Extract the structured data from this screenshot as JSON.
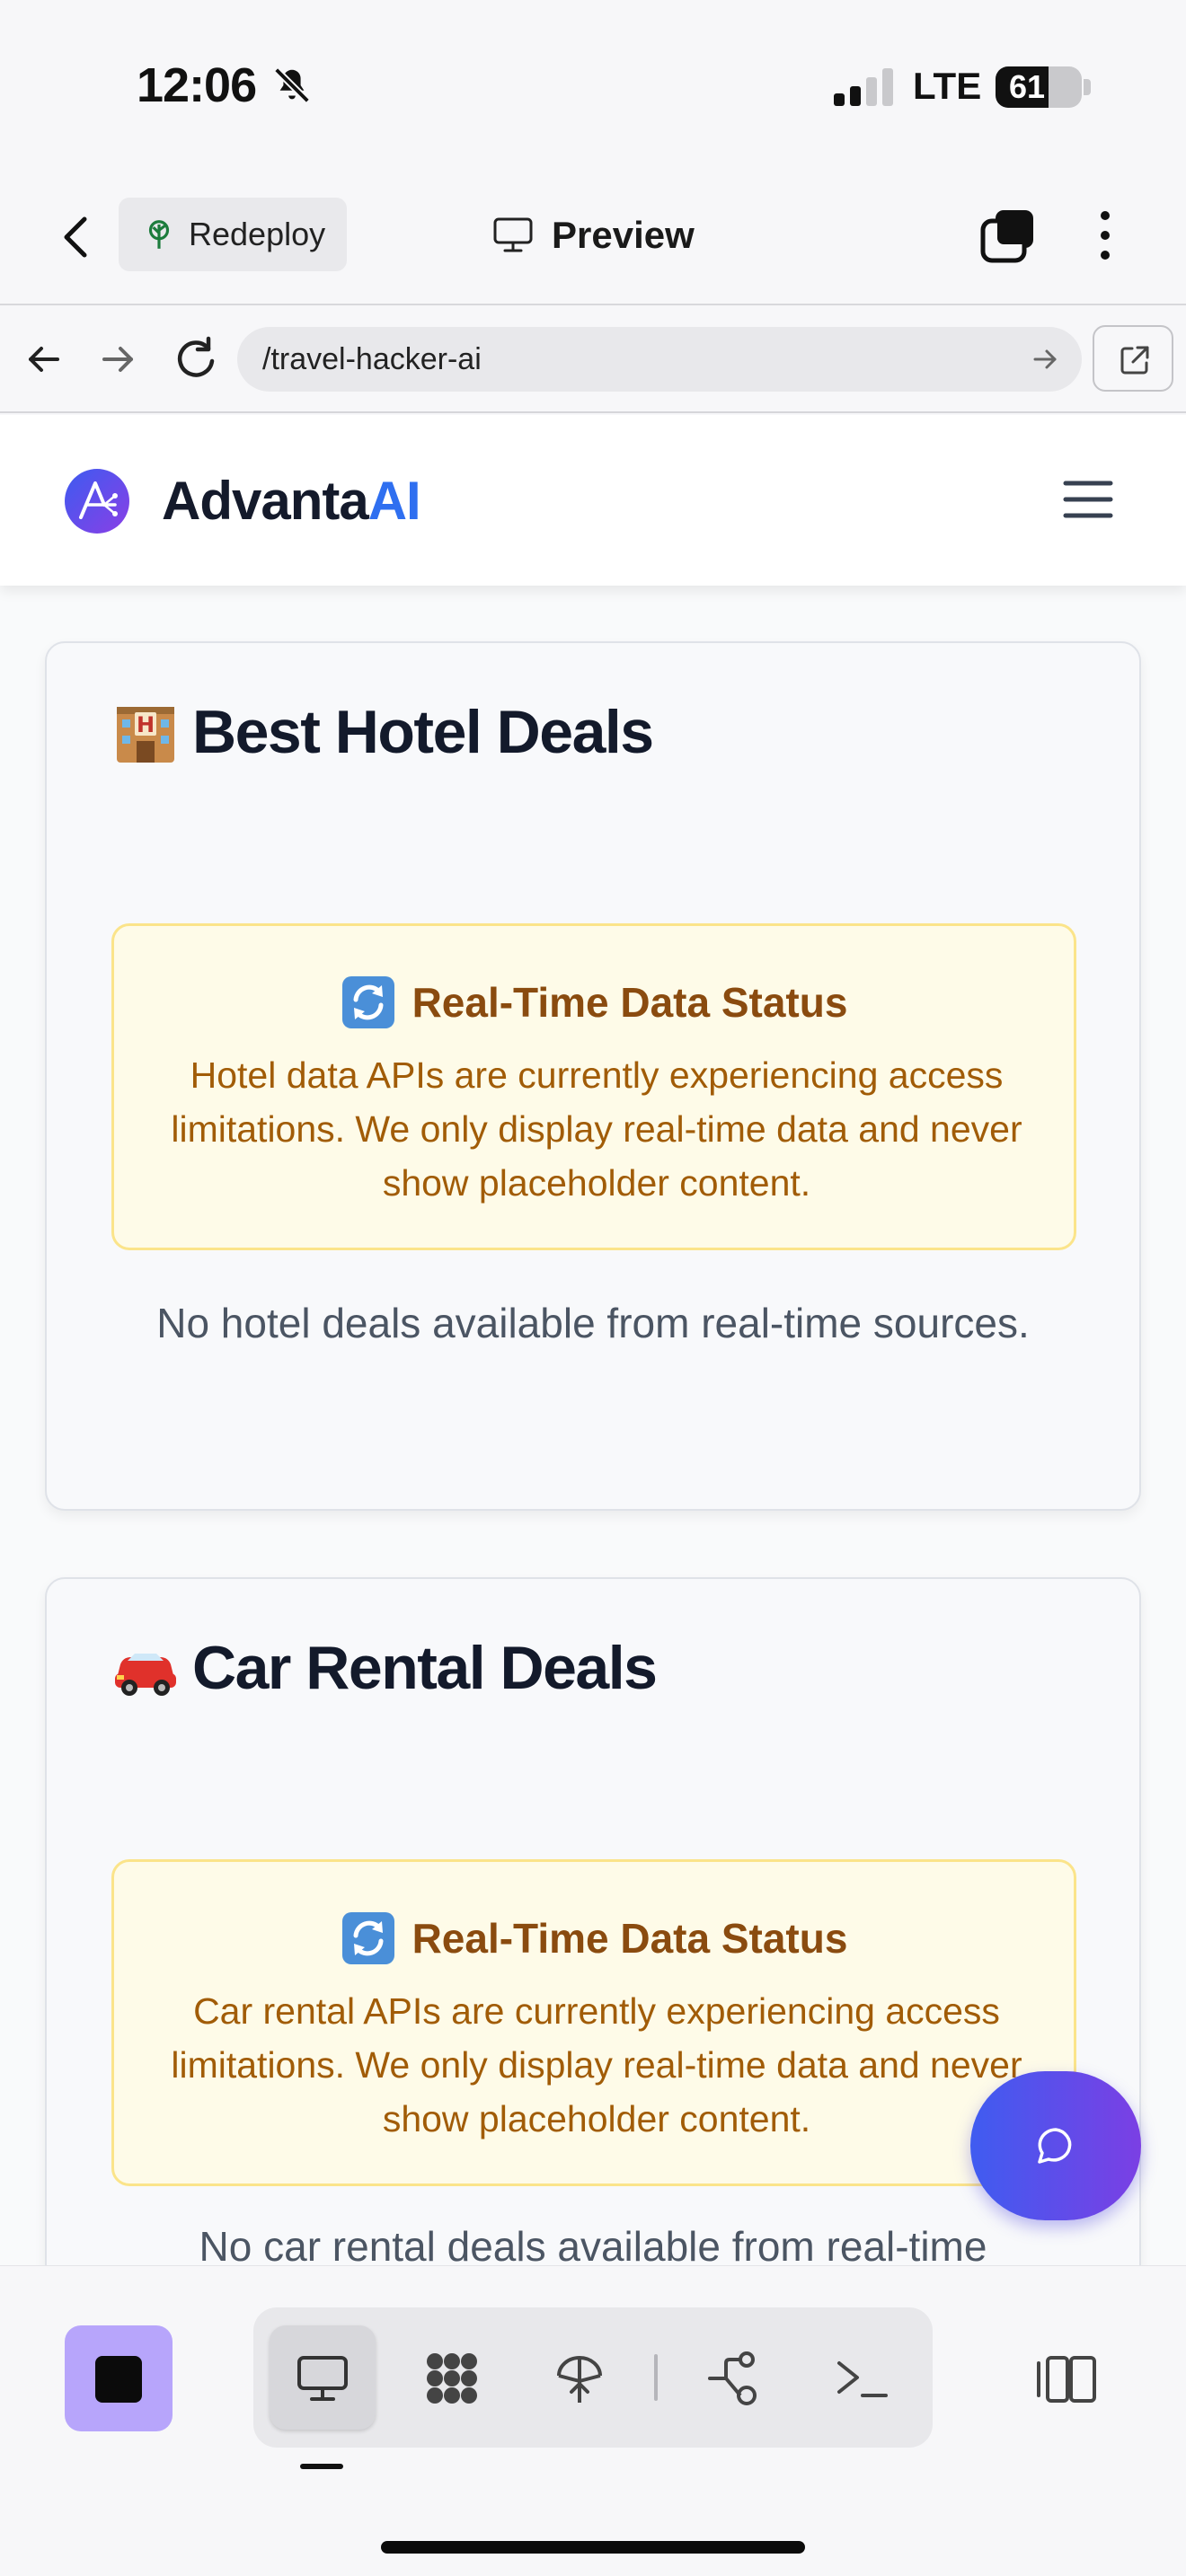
{
  "status_bar": {
    "time": "12:06",
    "network": "LTE",
    "battery_level": "61",
    "battery_fraction": 0.61
  },
  "header": {
    "redeploy_label": "Redeploy",
    "title": "Preview"
  },
  "browser": {
    "url": "/travel-hacker-ai"
  },
  "site": {
    "brand_part1": "Advanta",
    "brand_part2": "AI",
    "colors": {
      "brand_dark": "#141a2b",
      "brand_accent": "#2f6ff0"
    }
  },
  "hotel_card": {
    "title": "Best Hotel Deals",
    "title_icon": "hotel-emoji",
    "alert_title": "Real-Time Data Status",
    "alert_body": "Hotel data APIs are currently experiencing access limitations. We only display real-time data and never show placeholder content.",
    "empty_text": "No hotel deals available from real-time sources."
  },
  "car_card": {
    "title": "Car Rental Deals",
    "title_icon": "car-emoji",
    "alert_title": "Real-Time Data Status",
    "alert_body": "Car rental APIs are currently experiencing access limitations. We only display real-time data and never show placeholder content.",
    "empty_text": "No car rental deals available from real-time"
  },
  "toolbar": {
    "tools": [
      "preview-monitor",
      "apps-grid",
      "deploy",
      "git-branch",
      "terminal"
    ],
    "active_tool": "preview-monitor"
  },
  "colors": {
    "alert_bg": "#fefbe8",
    "alert_border": "#fbe48a",
    "alert_text": "#a15c07",
    "fab_gradient": [
      "#3f5cf0",
      "#7b3fe4"
    ],
    "stop_button": "#b7a5fb"
  }
}
